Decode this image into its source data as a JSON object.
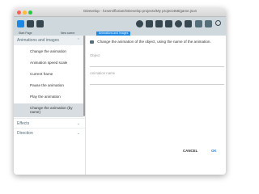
{
  "window": {
    "title": "GDevelop - /Users/florian/GDevelop projects/My project458/game.json",
    "traffic_lights": [
      "#ff5f57",
      "#febc2e",
      "#28c840"
    ]
  },
  "toolbar": {
    "icons": [
      "project-manager-icon",
      "layout-icon",
      "home-icon",
      "play-icon",
      "scene-icon",
      "events-icon",
      "preview-icon",
      "add-icon",
      "debug-icon",
      "undo-icon",
      "redo-icon",
      "search-icon"
    ]
  },
  "tabs": [
    "Start Page",
    "New scene",
    "Animations and images"
  ],
  "sidebar": {
    "section": "Animations and images",
    "items": [
      "Change the animation",
      "Animation speed scale",
      "Current frame",
      "Pause the animation",
      "Play the animation",
      "Change the animation (by name)"
    ],
    "selected_index": 5,
    "collapsed": [
      "Effects",
      "Direction"
    ]
  },
  "main": {
    "description": "Change the animation of the object, using the name of the animation.",
    "fields": [
      "Object",
      "Animation name"
    ]
  },
  "buttons": {
    "cancel": "CANCEL",
    "ok": "OK"
  },
  "colors": {
    "accent": "#1e88e5",
    "toolbar": "#cfd8dc",
    "selected": "#d7dde0"
  }
}
